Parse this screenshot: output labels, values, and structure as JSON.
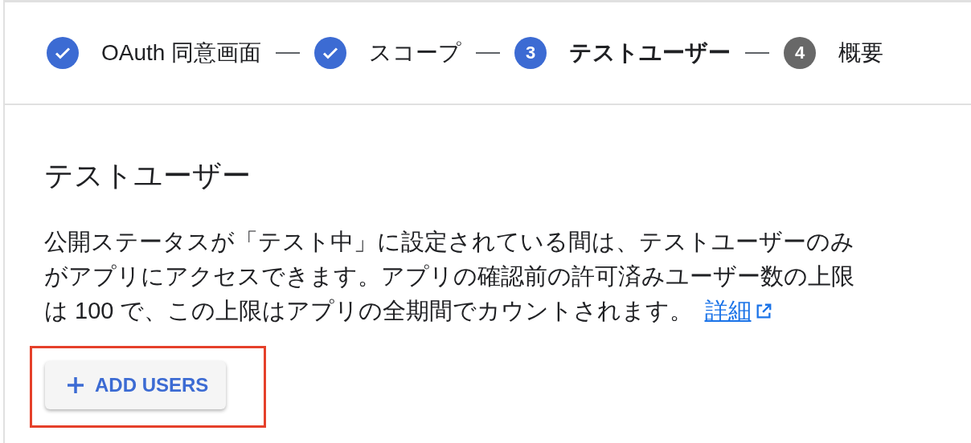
{
  "steps": [
    {
      "label": "OAuth 同意画面",
      "done": true,
      "selected": false
    },
    {
      "label": "スコープ",
      "done": true,
      "selected": false
    },
    {
      "number": "3",
      "label": "テストユーザー",
      "done": false,
      "selected": true
    },
    {
      "number": "4",
      "label": "概要",
      "done": false,
      "selected": false
    }
  ],
  "section": {
    "title": "テストユーザー",
    "description": "公開ステータスが「テスト中」に設定されている間は、テストユーザーのみがアプリにアクセスできます。アプリの確認前の許可済みユーザー数の上限は 100 で、この上限はアプリの全期間でカウントされます。",
    "link": "詳細"
  },
  "add_button": {
    "label": "ADD USERS",
    "highlighted": true
  }
}
